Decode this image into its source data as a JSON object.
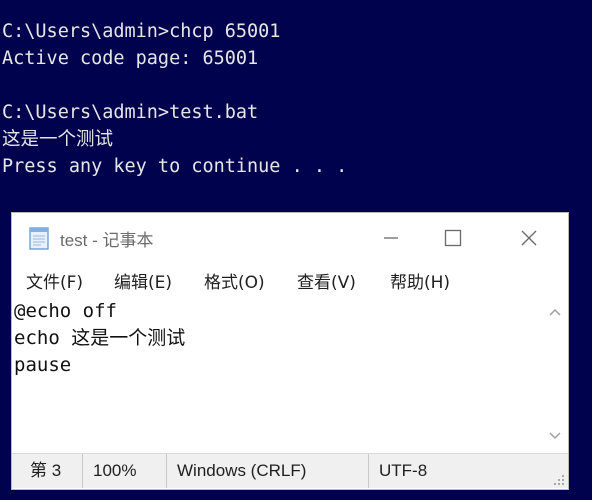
{
  "console": {
    "lines": [
      "C:\\Users\\admin>chcp 65001",
      "Active code page: 65001",
      "",
      "C:\\Users\\admin>test.bat",
      "这是一个测试",
      "Press any key to continue . . ."
    ]
  },
  "notepad": {
    "title": "test - 记事本",
    "icon": "notepad-icon",
    "window_buttons": [
      "minimize-icon",
      "maximize-icon",
      "close-icon"
    ],
    "menu": [
      "文件(F)",
      "编辑(E)",
      "格式(O)",
      "查看(V)",
      "帮助(H)"
    ],
    "content_lines": [
      "@echo off",
      "echo 这是一个测试",
      "pause"
    ],
    "status": {
      "position": "第 3",
      "zoom": "100%",
      "line_ending": "Windows (CRLF)",
      "encoding": "UTF-8"
    }
  },
  "colors": {
    "console_background": "#01024e",
    "console_text": "#e6e6e6",
    "statusbar": "#f0f0f0"
  }
}
